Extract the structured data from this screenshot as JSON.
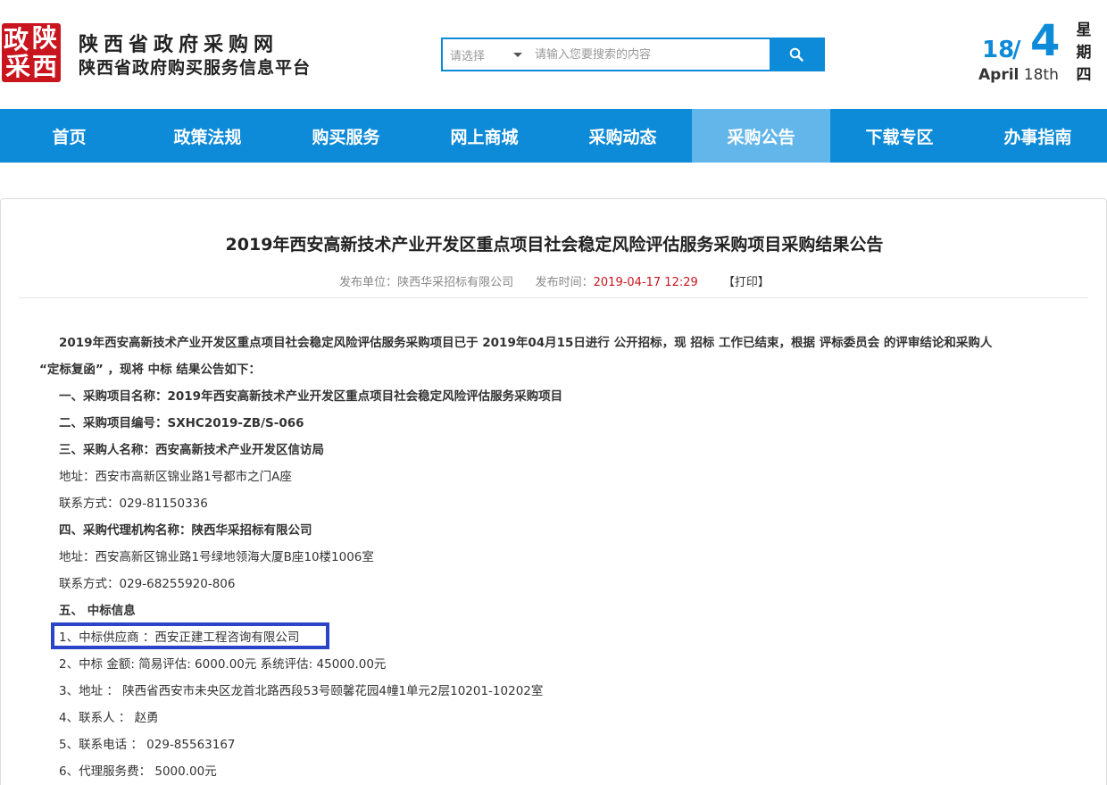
{
  "header": {
    "logo_chars": [
      "政",
      "陕",
      "采",
      "西"
    ],
    "site_name": "陕西省政府采购网",
    "site_subtitle": "陕西省政府购买服务信息平台",
    "search": {
      "select_placeholder": "请选择",
      "input_placeholder": "请输入您要搜索的内容",
      "button_icon": "search-icon"
    },
    "date": {
      "day": "18",
      "slash": "/",
      "month": "4",
      "month_name": "April",
      "day_ordinal": "18th",
      "weekday_chars": [
        "星",
        "期",
        "四"
      ]
    }
  },
  "nav": {
    "items": [
      {
        "label": "首页"
      },
      {
        "label": "政策法规"
      },
      {
        "label": "购买服务"
      },
      {
        "label": "网上商城"
      },
      {
        "label": "采购动态"
      },
      {
        "label": "采购公告",
        "active": true
      },
      {
        "label": "下载专区"
      },
      {
        "label": "办事指南"
      }
    ]
  },
  "article": {
    "title": "2019年西安高新技术产业开发区重点项目社会稳定风险评估服务采购项目采购结果公告",
    "publisher_label": "发布单位：",
    "publisher": "陕西华采招标有限公司",
    "time_label": "发布时间：",
    "time": "2019-04-17 12:29",
    "print_label": "【打印】",
    "intro_line1": "2019年西安高新技术产业开发区重点项目社会稳定风险评估服务采购项目已于 2019年04月15日进行 公开招标，现 招标 工作已结束，根据 评标委员会 的评审结论和采购人",
    "intro_line2": "“定标复函” ，现将 中标 结果公告如下：",
    "project_name": "一、采购项目名称：2019年西安高新技术产业开发区重点项目社会稳定风险评估服务采购项目",
    "project_no": "二、采购项目编号：SXHC2019-ZB/S-066",
    "purchaser": "三、采购人名称：西安高新技术产业开发区信访局",
    "purchaser_addr": "地址：西安市高新区锦业路1号都市之门A座",
    "purchaser_contact": "联系方式：029-81150336",
    "agency": "四、采购代理机构名称：陕西华采招标有限公司",
    "agency_addr": "地址：西安高新区锦业路1号绿地领海大厦B座10楼1006室",
    "agency_contact": "联系方式：029-68255920-806",
    "winner_heading": "五、 中标信息",
    "winner_supplier": "1、中标供应商 ：西安正建工程咨询有限公司",
    "winner_amount": "2、中标 金额: 简易评估: 6000.00元 系统评估: 45000.00元",
    "winner_addr": "3、地址 ： 陕西省西安市未央区龙首北路西段53号颐馨花园4幢1单元2层10201-10202室",
    "winner_contact": "4、联系人 ： 赵勇",
    "winner_phone": "5、联系电话 ： 029-85563167",
    "agency_fee": "6、代理服务费： 5000.00元"
  },
  "colors": {
    "brand_blue": "#0d8ad8",
    "nav_active": "#63b6ea",
    "logo_red": "#c9151e",
    "highlight_box": "#2b44c8"
  }
}
